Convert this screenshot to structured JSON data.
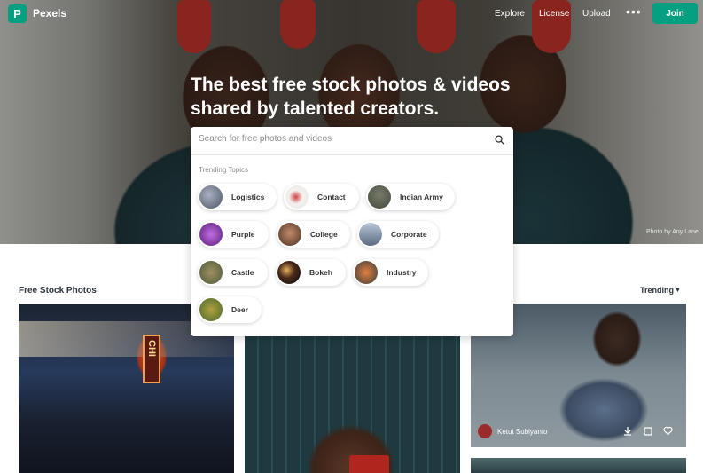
{
  "nav": {
    "brand": "Pexels",
    "logo_letter": "P",
    "links": [
      "Explore",
      "License",
      "Upload"
    ],
    "more": "•••",
    "join": "Join"
  },
  "hero": {
    "headline": "The best free stock photos & videos shared by talented creators.",
    "credit": "Photo by Any Lane"
  },
  "search": {
    "placeholder": "Search for free photos and videos",
    "trending_label": "Trending Topics",
    "topics": [
      "Logistics",
      "Contact",
      "Indian Army",
      "Purple",
      "College",
      "Corporate",
      "Castle",
      "Bokeh",
      "Industry",
      "Deer"
    ]
  },
  "section": {
    "title": "Free Stock Photos",
    "sort": "Trending"
  },
  "photos": {
    "sign_text": "CHI",
    "author": "Ketut Subiyanto"
  },
  "colors": {
    "accent": "#05a081"
  },
  "icons": [
    "search-icon",
    "download-icon",
    "collect-icon",
    "heart-icon",
    "chevron-down-icon",
    "more-icon"
  ]
}
